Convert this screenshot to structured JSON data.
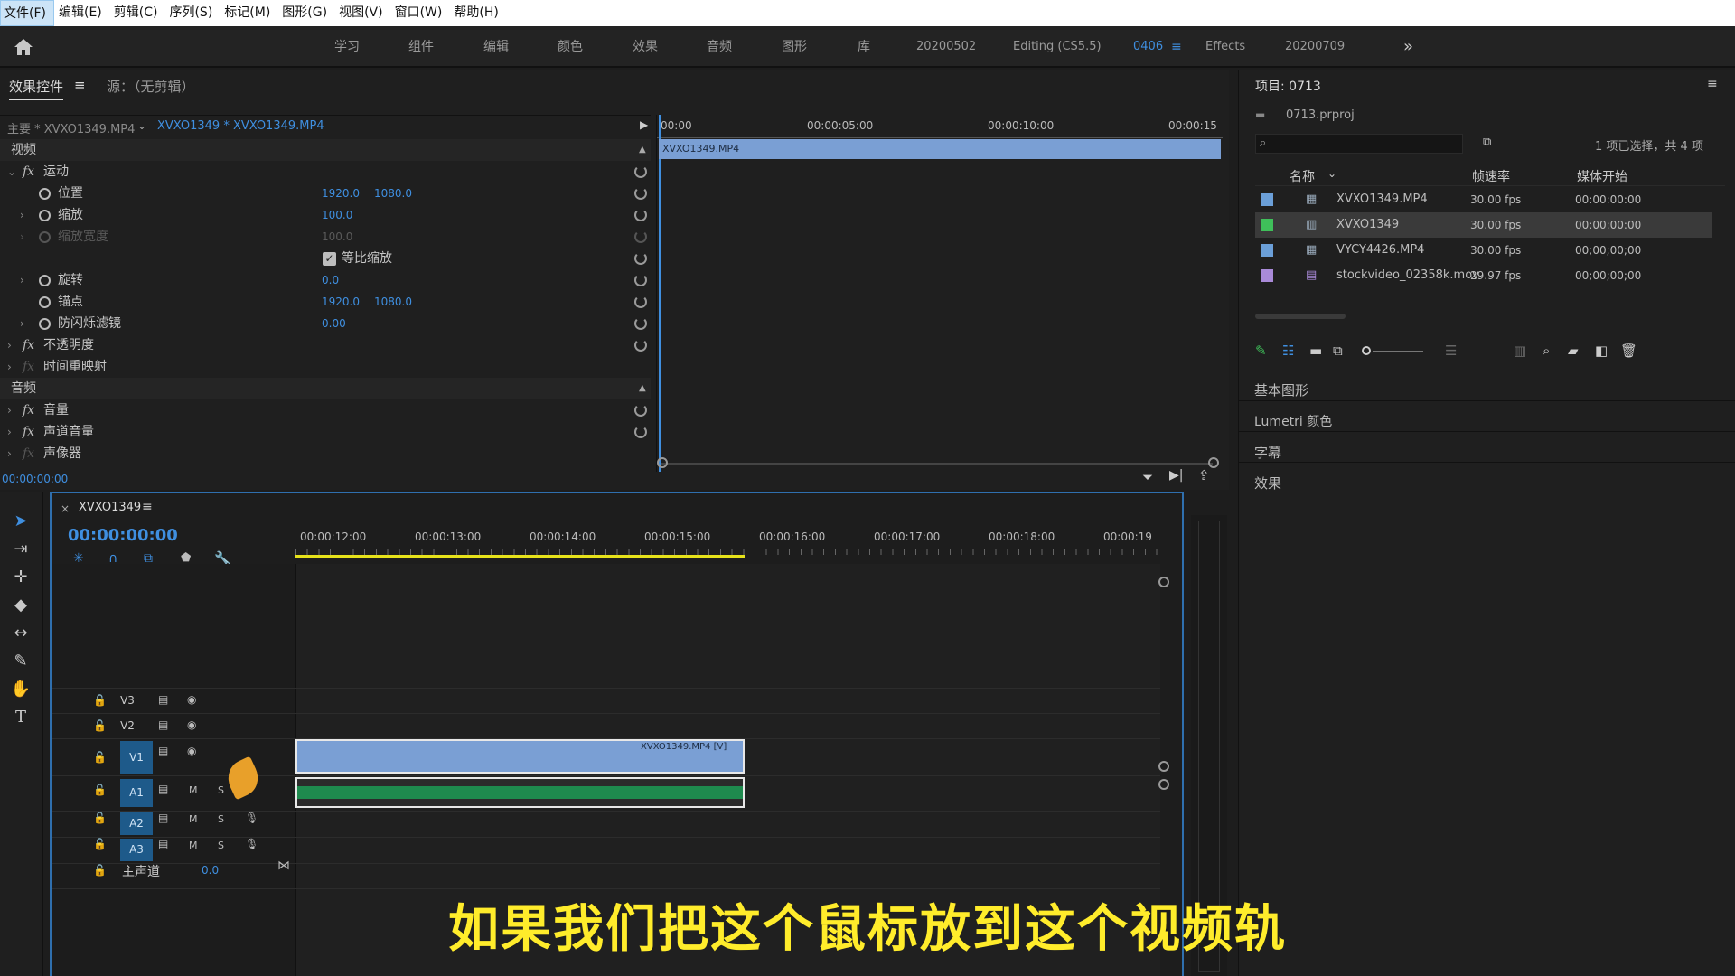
{
  "menu": [
    "文件(F)",
    "编辑(E)",
    "剪辑(C)",
    "序列(S)",
    "标记(M)",
    "图形(G)",
    "视图(V)",
    "窗口(W)",
    "帮助(H)"
  ],
  "workspaces": [
    "学习",
    "组件",
    "编辑",
    "颜色",
    "效果",
    "音频",
    "图形",
    "库",
    "20200502",
    "Editing (CS5.5)",
    "0406",
    "Effects",
    "20200709"
  ],
  "active_workspace": "0406",
  "effect_controls": {
    "tab_label": "效果控件",
    "source_label": "源：（无剪辑）",
    "master_clip": "主要 * XVXO1349.MP4",
    "sequence_clip": "XVXO1349 * XVXO1349.MP4",
    "video_section": "视频",
    "audio_section": "音频",
    "motion": "运动",
    "position_label": "位置",
    "position_x": "1920.0",
    "position_y": "1080.0",
    "scale_label": "缩放",
    "scale_value": "100.0",
    "scale_width_label": "缩放宽度",
    "scale_width_value": "100.0",
    "uniform_scale": "等比缩放",
    "rotation_label": "旋转",
    "rotation_value": "0.0",
    "anchor_label": "锚点",
    "anchor_x": "1920.0",
    "anchor_y": "1080.0",
    "antiflicker_label": "防闪烁滤镜",
    "antiflicker_value": "0.00",
    "opacity": "不透明度",
    "time_remap": "时间重映射",
    "volume": "音量",
    "channel_volume": "声道音量",
    "panner": "声像器",
    "timecode": "00:00:00:00",
    "mini_ruler": [
      "00:00",
      "00:00:05:00",
      "00:00:10:00",
      "00:00:15"
    ],
    "mini_clip": "XVXO1349.MP4"
  },
  "timeline": {
    "sequence_name": "XVXO1349",
    "timecode": "00:00:00:00",
    "ruler": [
      "00:00:12:00",
      "00:00:13:00",
      "00:00:14:00",
      "00:00:15:00",
      "00:00:16:00",
      "00:00:17:00",
      "00:00:18:00",
      "00:00:19"
    ],
    "tracks": [
      "V3",
      "V2",
      "V1",
      "A1",
      "A2",
      "A3"
    ],
    "master_label": "主声道",
    "master_value": "0.0",
    "clip_label": "XVXO1349.MP4 [V]",
    "m_label": "M",
    "s_label": "S"
  },
  "project": {
    "title": "项目: 0713",
    "file": "0713.prproj",
    "selection_info": "1 项已选择，共 4 项",
    "columns": [
      "名称",
      "帧速率",
      "媒体开始"
    ],
    "items": [
      {
        "name": "XVXO1349.MP4",
        "fps": "30.00 fps",
        "start": "00:00:00:00",
        "color": "#6b9fd8"
      },
      {
        "name": "XVXO1349",
        "fps": "30.00 fps",
        "start": "00:00:00:00",
        "color": "#3fbf5a"
      },
      {
        "name": "VYCY4426.MP4",
        "fps": "30.00 fps",
        "start": "00;00;00;00",
        "color": "#6b9fd8"
      },
      {
        "name": "stockvideo_02358k.mov",
        "fps": "29.97 fps",
        "start": "00;00;00;00",
        "color": "#a98ad8"
      }
    ]
  },
  "side_panels": [
    "基本图形",
    "Lumetri 颜色",
    "字幕",
    "效果"
  ],
  "subtitle": "如果我们把这个鼠标放到这个视频轨"
}
